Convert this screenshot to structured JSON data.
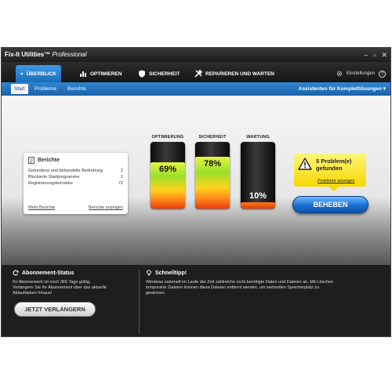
{
  "window": {
    "app_name": "Fix-It Utilities™",
    "edition": "Professional",
    "minimize": "–",
    "maximize": "▫",
    "close": "✕"
  },
  "nav": {
    "tabs": [
      {
        "label": "ÜBERBLICK",
        "icon": "home-icon"
      },
      {
        "label": "OPTIMIEREN",
        "icon": "bar-chart-icon"
      },
      {
        "label": "SICHERHEIT",
        "icon": "shield-icon"
      },
      {
        "label": "REPARIEREN UND WARTEN",
        "icon": "tools-icon"
      }
    ],
    "settings_label": "Einstellungen",
    "help_label": "?"
  },
  "subnav": {
    "tabs": [
      "Start",
      "Probleme",
      "Berichte"
    ],
    "assistant_label": "Assistenten für Komplettlösungen ▾"
  },
  "report_card": {
    "title": "Berichte",
    "rows": [
      {
        "label": "Gefundene und behandelte Bedrohung",
        "value": "2"
      },
      {
        "label": "Blockierte Startprogramme",
        "value": "1"
      },
      {
        "label": "Registrierungskorrektur",
        "value": "72"
      }
    ],
    "more_link": "Mehr Berichte",
    "all_link": "Berichte anzeigen"
  },
  "gauges": [
    {
      "label": "OPTIMIERUNG",
      "percent_text": "69%",
      "level": 69
    },
    {
      "label": "SICHERHEIT",
      "percent_text": "78%",
      "level": 78
    },
    {
      "label": "WARTUNG",
      "percent_text": "10%",
      "level": 10
    }
  ],
  "problems": {
    "title_line1": "5 Problem(e)",
    "title_line2": "gefunden",
    "link": "Probleme anzeigen"
  },
  "fix_button": "BEHEBEN",
  "subscription": {
    "title": "Abonnement-Status",
    "text_line1": "Ihr Abonnement ist noch 365 Tage gültig.",
    "text_line2": "Verlängern Sie Ihr Abonnement über das aktuelle",
    "text_line3": "Ablaufdatum hinaus!",
    "button": "JETZT VERLÄNGERN"
  },
  "quicktip": {
    "title": "Schnelltipp!",
    "text_line1": "Windows sammelt im Laufe der Zeit zahlreiche nicht benötigte Daten und Dateien an. Mit Löschen",
    "text_line2": "temporärer Dateien können diese Dateien entfernt werden, um wertvollen Speicherplatz zu",
    "text_line3": "gewinnen."
  },
  "colors": {
    "accent_blue": "#1f6fc0",
    "warning_yellow": "#f5d800"
  }
}
